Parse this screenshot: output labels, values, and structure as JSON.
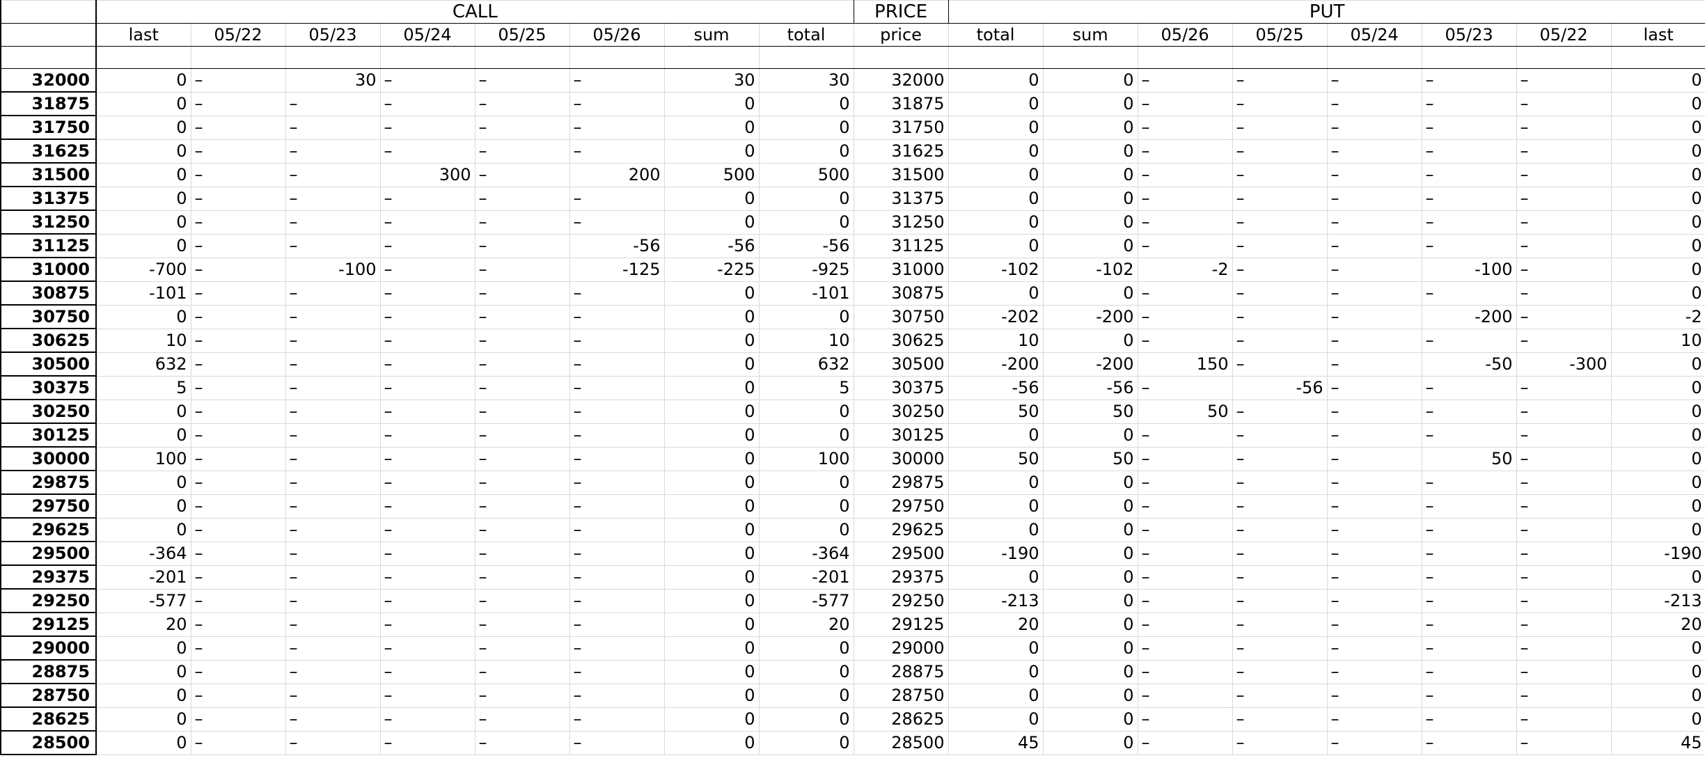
{
  "groups": {
    "call": "CALL",
    "price": "PRICE",
    "put": "PUT"
  },
  "headers": [
    "last",
    "05/22",
    "05/23",
    "05/24",
    "05/25",
    "05/26",
    "sum",
    "total",
    "price",
    "total",
    "sum",
    "05/26",
    "05/25",
    "05/24",
    "05/23",
    "05/22",
    "last"
  ],
  "rows": [
    [
      "32000",
      "0",
      "–",
      "30",
      "–",
      "–",
      "–",
      "30",
      "30",
      "32000",
      "0",
      "0",
      "–",
      "–",
      "–",
      "–",
      "–",
      "0"
    ],
    [
      "31875",
      "0",
      "–",
      "–",
      "–",
      "–",
      "–",
      "0",
      "0",
      "31875",
      "0",
      "0",
      "–",
      "–",
      "–",
      "–",
      "–",
      "0"
    ],
    [
      "31750",
      "0",
      "–",
      "–",
      "–",
      "–",
      "–",
      "0",
      "0",
      "31750",
      "0",
      "0",
      "–",
      "–",
      "–",
      "–",
      "–",
      "0"
    ],
    [
      "31625",
      "0",
      "–",
      "–",
      "–",
      "–",
      "–",
      "0",
      "0",
      "31625",
      "0",
      "0",
      "–",
      "–",
      "–",
      "–",
      "–",
      "0"
    ],
    [
      "31500",
      "0",
      "–",
      "–",
      "300",
      "–",
      "200",
      "500",
      "500",
      "31500",
      "0",
      "0",
      "–",
      "–",
      "–",
      "–",
      "–",
      "0"
    ],
    [
      "31375",
      "0",
      "–",
      "–",
      "–",
      "–",
      "–",
      "0",
      "0",
      "31375",
      "0",
      "0",
      "–",
      "–",
      "–",
      "–",
      "–",
      "0"
    ],
    [
      "31250",
      "0",
      "–",
      "–",
      "–",
      "–",
      "–",
      "0",
      "0",
      "31250",
      "0",
      "0",
      "–",
      "–",
      "–",
      "–",
      "–",
      "0"
    ],
    [
      "31125",
      "0",
      "–",
      "–",
      "–",
      "–",
      "-56",
      "-56",
      "-56",
      "31125",
      "0",
      "0",
      "–",
      "–",
      "–",
      "–",
      "–",
      "0"
    ],
    [
      "31000",
      "-700",
      "–",
      "-100",
      "–",
      "–",
      "-125",
      "-225",
      "-925",
      "31000",
      "-102",
      "-102",
      "-2",
      "–",
      "–",
      "-100",
      "–",
      "0"
    ],
    [
      "30875",
      "-101",
      "–",
      "–",
      "–",
      "–",
      "–",
      "0",
      "-101",
      "30875",
      "0",
      "0",
      "–",
      "–",
      "–",
      "–",
      "–",
      "0"
    ],
    [
      "30750",
      "0",
      "–",
      "–",
      "–",
      "–",
      "–",
      "0",
      "0",
      "30750",
      "-202",
      "-200",
      "–",
      "–",
      "–",
      "-200",
      "–",
      "-2"
    ],
    [
      "30625",
      "10",
      "–",
      "–",
      "–",
      "–",
      "–",
      "0",
      "10",
      "30625",
      "10",
      "0",
      "–",
      "–",
      "–",
      "–",
      "–",
      "10"
    ],
    [
      "30500",
      "632",
      "–",
      "–",
      "–",
      "–",
      "–",
      "0",
      "632",
      "30500",
      "-200",
      "-200",
      "150",
      "–",
      "–",
      "-50",
      "-300",
      "0"
    ],
    [
      "30375",
      "5",
      "–",
      "–",
      "–",
      "–",
      "–",
      "0",
      "5",
      "30375",
      "-56",
      "-56",
      "–",
      "-56",
      "–",
      "–",
      "–",
      "0"
    ],
    [
      "30250",
      "0",
      "–",
      "–",
      "–",
      "–",
      "–",
      "0",
      "0",
      "30250",
      "50",
      "50",
      "50",
      "–",
      "–",
      "–",
      "–",
      "0"
    ],
    [
      "30125",
      "0",
      "–",
      "–",
      "–",
      "–",
      "–",
      "0",
      "0",
      "30125",
      "0",
      "0",
      "–",
      "–",
      "–",
      "–",
      "–",
      "0"
    ],
    [
      "30000",
      "100",
      "–",
      "–",
      "–",
      "–",
      "–",
      "0",
      "100",
      "30000",
      "50",
      "50",
      "–",
      "–",
      "–",
      "50",
      "–",
      "0"
    ],
    [
      "29875",
      "0",
      "–",
      "–",
      "–",
      "–",
      "–",
      "0",
      "0",
      "29875",
      "0",
      "0",
      "–",
      "–",
      "–",
      "–",
      "–",
      "0"
    ],
    [
      "29750",
      "0",
      "–",
      "–",
      "–",
      "–",
      "–",
      "0",
      "0",
      "29750",
      "0",
      "0",
      "–",
      "–",
      "–",
      "–",
      "–",
      "0"
    ],
    [
      "29625",
      "0",
      "–",
      "–",
      "–",
      "–",
      "–",
      "0",
      "0",
      "29625",
      "0",
      "0",
      "–",
      "–",
      "–",
      "–",
      "–",
      "0"
    ],
    [
      "29500",
      "-364",
      "–",
      "–",
      "–",
      "–",
      "–",
      "0",
      "-364",
      "29500",
      "-190",
      "0",
      "–",
      "–",
      "–",
      "–",
      "–",
      "-190"
    ],
    [
      "29375",
      "-201",
      "–",
      "–",
      "–",
      "–",
      "–",
      "0",
      "-201",
      "29375",
      "0",
      "0",
      "–",
      "–",
      "–",
      "–",
      "–",
      "0"
    ],
    [
      "29250",
      "-577",
      "–",
      "–",
      "–",
      "–",
      "–",
      "0",
      "-577",
      "29250",
      "-213",
      "0",
      "–",
      "–",
      "–",
      "–",
      "–",
      "-213"
    ],
    [
      "29125",
      "20",
      "–",
      "–",
      "–",
      "–",
      "–",
      "0",
      "20",
      "29125",
      "20",
      "0",
      "–",
      "–",
      "–",
      "–",
      "–",
      "20"
    ],
    [
      "29000",
      "0",
      "–",
      "–",
      "–",
      "–",
      "–",
      "0",
      "0",
      "29000",
      "0",
      "0",
      "–",
      "–",
      "–",
      "–",
      "–",
      "0"
    ],
    [
      "28875",
      "0",
      "–",
      "–",
      "–",
      "–",
      "–",
      "0",
      "0",
      "28875",
      "0",
      "0",
      "–",
      "–",
      "–",
      "–",
      "–",
      "0"
    ],
    [
      "28750",
      "0",
      "–",
      "–",
      "–",
      "–",
      "–",
      "0",
      "0",
      "28750",
      "0",
      "0",
      "–",
      "–",
      "–",
      "–",
      "–",
      "0"
    ],
    [
      "28625",
      "0",
      "–",
      "–",
      "–",
      "–",
      "–",
      "0",
      "0",
      "28625",
      "0",
      "0",
      "–",
      "–",
      "–",
      "–",
      "–",
      "0"
    ],
    [
      "28500",
      "0",
      "–",
      "–",
      "–",
      "–",
      "–",
      "0",
      "0",
      "28500",
      "45",
      "0",
      "–",
      "–",
      "–",
      "–",
      "–",
      "45"
    ]
  ]
}
